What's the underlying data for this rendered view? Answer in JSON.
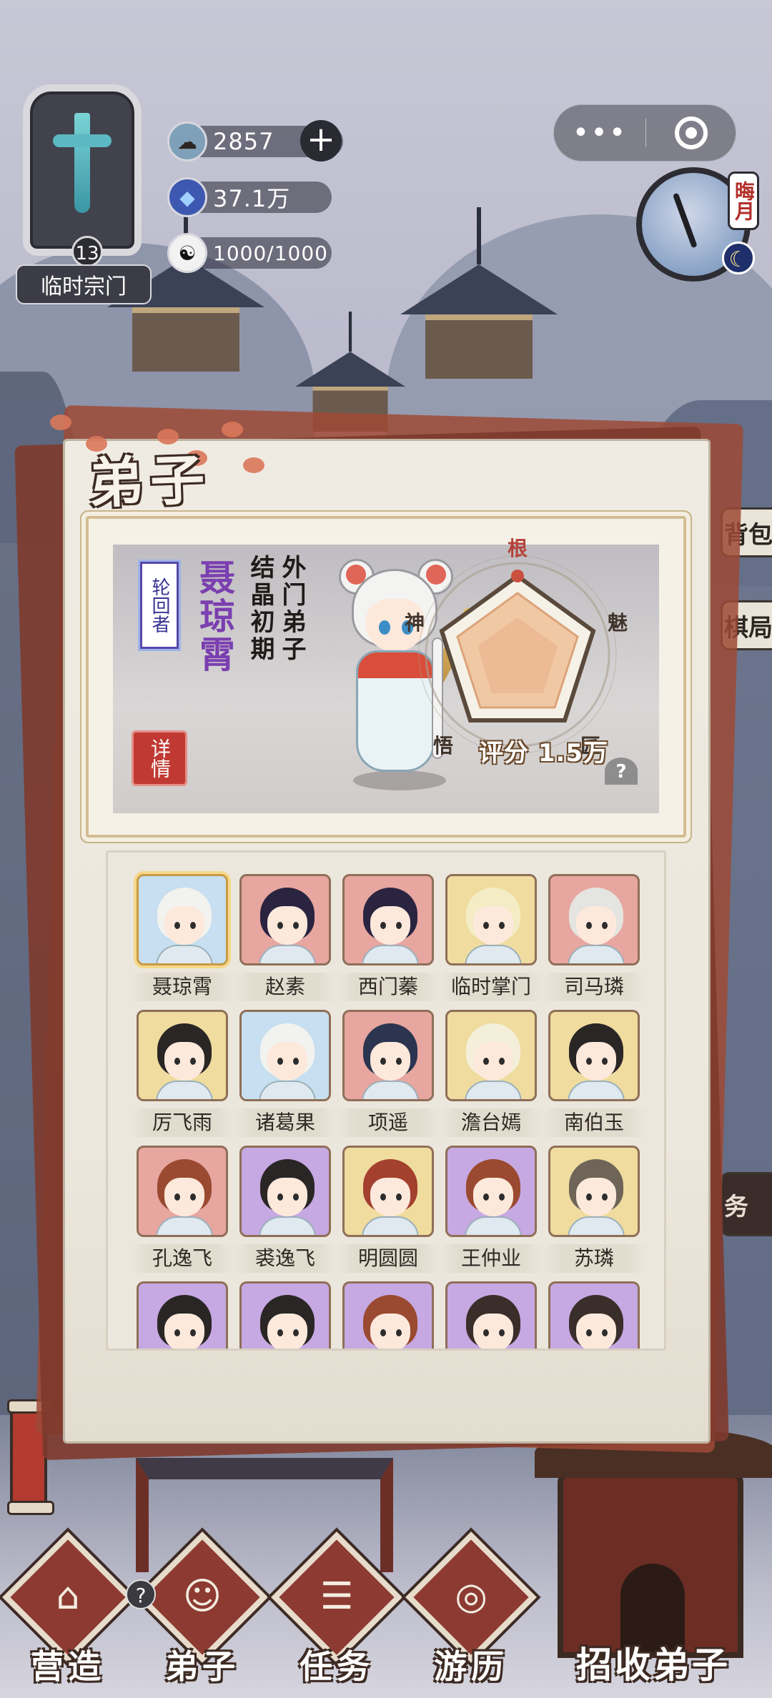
{
  "hud": {
    "sect_level": "13",
    "sect_name": "临时宗门",
    "resources": [
      {
        "icon": "cloud-coin-icon",
        "value": "2857"
      },
      {
        "icon": "crystal-icon",
        "value": "37.1万"
      },
      {
        "icon": "yin-yang-icon",
        "value": "1000/1000"
      }
    ],
    "plus_label": "+",
    "capsule_more": "•••",
    "time_tag": "晦月",
    "moon_glyph": "☾"
  },
  "side_stubs": [
    "背包",
    "棋局",
    "务"
  ],
  "panel": {
    "title": "弟子",
    "profile": {
      "rank": "轮回者",
      "name": "聂琼霄",
      "realm": "结晶初期",
      "role": "外门弟子",
      "detail_button": "详情",
      "radar_labels": {
        "root": "根",
        "charm": "魅",
        "craft": "匠",
        "wisdom": "悟",
        "spirit": "神"
      },
      "score_label": "评分",
      "score_value": "1.5万",
      "help": "?"
    },
    "disciples": [
      {
        "name": "聂琼霄",
        "bg": "blue",
        "hair": "#f2f2ef",
        "selected": true
      },
      {
        "name": "赵素",
        "bg": "pink",
        "hair": "#2b2440"
      },
      {
        "name": "西门蓁",
        "bg": "pink",
        "hair": "#2b2440"
      },
      {
        "name": "临时掌门",
        "bg": "yellow",
        "hair": "#f3ecc4"
      },
      {
        "name": "司马璘",
        "bg": "pink",
        "hair": "#e4e4e0"
      },
      {
        "name": "厉飞雨",
        "bg": "yellow",
        "hair": "#2a2626"
      },
      {
        "name": "诸葛果",
        "bg": "blue",
        "hair": "#f2f2ef"
      },
      {
        "name": "项遥",
        "bg": "pink",
        "hair": "#2c3550"
      },
      {
        "name": "澹台嫣",
        "bg": "yellow",
        "hair": "#f3efd8"
      },
      {
        "name": "南伯玉",
        "bg": "yellow",
        "hair": "#2a2626"
      },
      {
        "name": "孔逸飞",
        "bg": "pink",
        "hair": "#9a4a30"
      },
      {
        "name": "裘逸飞",
        "bg": "purple",
        "hair": "#2a2626"
      },
      {
        "name": "明圆圆",
        "bg": "yellow",
        "hair": "#a3402e"
      },
      {
        "name": "王仲业",
        "bg": "purple",
        "hair": "#9a4a30"
      },
      {
        "name": "苏璘",
        "bg": "yellow",
        "hair": "#6e6558"
      },
      {
        "name": "",
        "bg": "purple",
        "hair": "#2a2626"
      },
      {
        "name": "",
        "bg": "purple",
        "hair": "#2a2626"
      },
      {
        "name": "",
        "bg": "purple",
        "hair": "#9a4a30"
      },
      {
        "name": "",
        "bg": "purple",
        "hair": "#3a2e2a"
      },
      {
        "name": "",
        "bg": "purple",
        "hair": "#3a2e2a"
      }
    ]
  },
  "nav": [
    {
      "label": "营造",
      "icon": "building-icon",
      "glyph": "⌂"
    },
    {
      "label": "弟子",
      "icon": "disciple-icon",
      "glyph": "☺"
    },
    {
      "label": "任务",
      "icon": "scroll-task-icon",
      "glyph": "☰"
    },
    {
      "label": "游历",
      "icon": "travel-spiral-icon",
      "glyph": "◎"
    }
  ],
  "nav_help": "?",
  "recruit_label": "招收弟子"
}
